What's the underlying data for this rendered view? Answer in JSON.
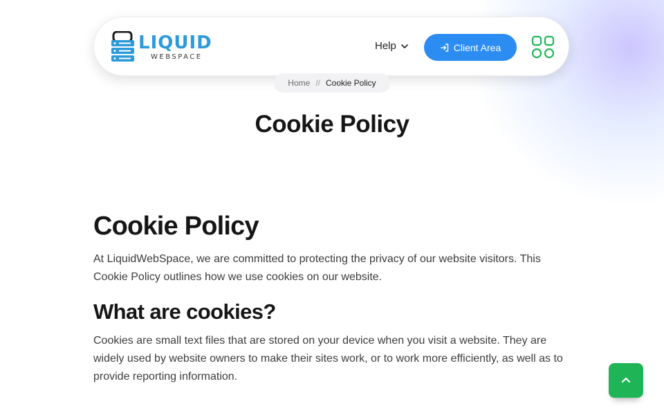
{
  "brand": {
    "name": "LIQUID",
    "tagline": "WEBSPACE",
    "colors": {
      "primary": "#2b8cf2",
      "accent_green": "#1fb556",
      "logo_blue": "#2d9ad9"
    }
  },
  "nav": {
    "help_label": "Help",
    "client_area_label": "Client Area",
    "icons": {
      "help_chevron": "chevron-down-icon",
      "client_area": "login-icon",
      "apps": "apps-grid-icon"
    }
  },
  "breadcrumb": {
    "home": "Home",
    "separator": "//",
    "current": "Cookie Policy"
  },
  "hero": {
    "title": "Cookie Policy"
  },
  "article": {
    "heading": "Cookie Policy",
    "intro": "At LiquidWebSpace, we are committed to protecting the privacy of our website visitors. This Cookie Policy outlines how we use cookies on our website.",
    "section_heading": "What are cookies?",
    "section_body": "Cookies are small text files that are stored on your device when you visit a website. They are widely used by website owners to make their sites work, or to work more efficiently, as well as to provide reporting information."
  },
  "back_to_top": {
    "icon": "chevron-up-icon"
  }
}
